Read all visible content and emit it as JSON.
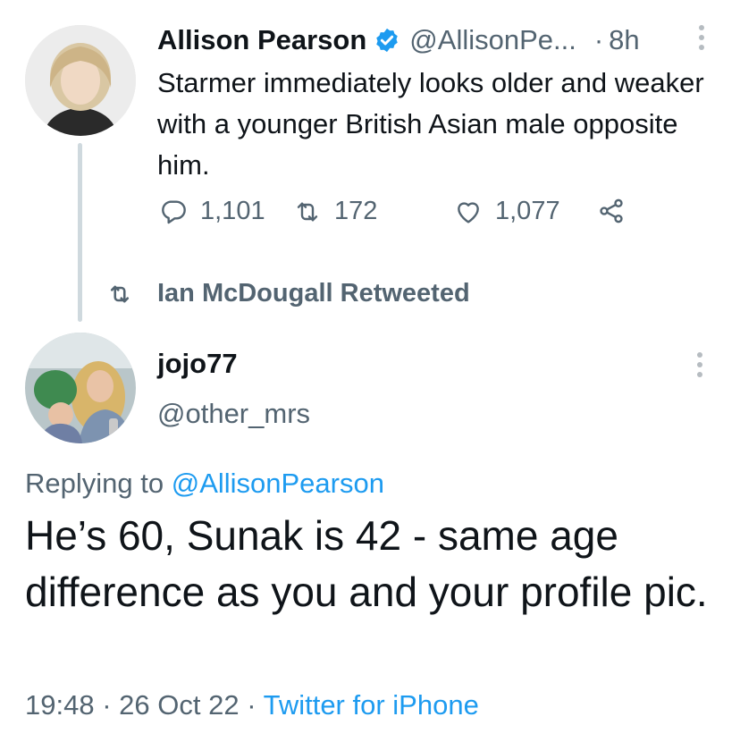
{
  "parent_tweet": {
    "name": "Allison Pearson",
    "handle": "@AllisonPe...",
    "separator": "·",
    "time": "8h",
    "text": "Starmer immediately looks older and weaker with a younger British Asian male opposite him.",
    "replies": "1,101",
    "retweets": "172",
    "likes": "1,077"
  },
  "retweet_notice": "Ian McDougall Retweeted",
  "tweet": {
    "name": "jojo77",
    "handle": "@other_mrs",
    "replying_prefix": "Replying to",
    "replying_to": "@AllisonPearson",
    "text": "He’s 60, Sunak is 42 - same age difference as you and your profile pic.",
    "time": "19:48",
    "date": "26 Oct 22",
    "sep": "·",
    "source": "Twitter for iPhone"
  },
  "icons": {
    "verified": "verified-badge-icon",
    "more": "more-vertical-icon",
    "reply": "reply-icon",
    "retweet": "retweet-icon",
    "like": "heart-icon",
    "share": "share-icon"
  },
  "colors": {
    "accent": "#1d9bf0",
    "text": "#0f1419",
    "secondary": "#536471",
    "thread_line": "#cfd9de"
  }
}
